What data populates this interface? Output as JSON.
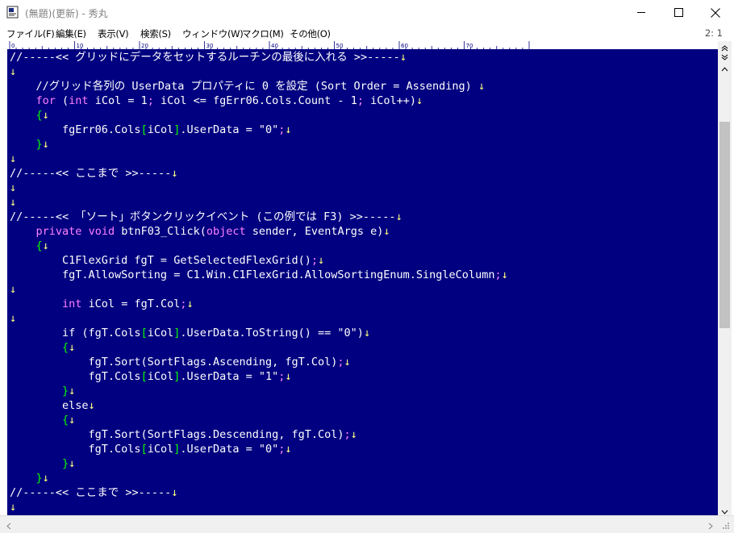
{
  "window": {
    "title": "(無題)(更新) - 秀丸"
  },
  "menu": {
    "items": [
      "ファイル(F)",
      "編集(E)",
      "表示(V)",
      "検索(S)",
      "ウィンドウ(W)",
      "マクロ(M)",
      "その他(O)"
    ],
    "position": "2: 1"
  },
  "ruler": {
    "labels": [
      "0",
      "10",
      "20",
      "30",
      "40",
      "50",
      "60",
      "70"
    ]
  },
  "editor": {
    "colors": {
      "background": "#000080",
      "text": "#ffffff",
      "keyword": "#ff80ff",
      "bracket": "#00ff00",
      "return_mark": "#ffff80"
    },
    "lines": [
      [
        [
          "c",
          "//-----<< グリッドにデータをセットするルーチンの最後に入れる >>-----"
        ],
        [
          "r",
          "↓"
        ]
      ],
      [
        [
          "r",
          "↓"
        ]
      ],
      [
        [
          "t",
          "    //グリッド各列の UserData プロパティに 0 を設定 (Sort Order = Assending) "
        ],
        [
          "r",
          "↓"
        ]
      ],
      [
        [
          "t",
          "    "
        ],
        [
          "k",
          "for"
        ],
        [
          "t",
          " ("
        ],
        [
          "k",
          "int"
        ],
        [
          "t",
          " iCol = 1"
        ],
        [
          "k",
          ";"
        ],
        [
          "t",
          " iCol <= fgErr06.Cols.Count - 1"
        ],
        [
          "k",
          ";"
        ],
        [
          "t",
          " iCol++)"
        ],
        [
          "r",
          "↓"
        ]
      ],
      [
        [
          "t",
          "    "
        ],
        [
          "b",
          "{"
        ],
        [
          "r",
          "↓"
        ]
      ],
      [
        [
          "t",
          "        fgErr06.Cols"
        ],
        [
          "b",
          "["
        ],
        [
          "t",
          "iCol"
        ],
        [
          "b",
          "]"
        ],
        [
          "t",
          ".UserData = \"0\""
        ],
        [
          "k",
          ";"
        ],
        [
          "r",
          "↓"
        ]
      ],
      [
        [
          "t",
          "    "
        ],
        [
          "b",
          "}"
        ],
        [
          "r",
          "↓"
        ]
      ],
      [
        [
          "r",
          "↓"
        ]
      ],
      [
        [
          "c",
          "//-----<< ここまで >>-----"
        ],
        [
          "r",
          "↓"
        ]
      ],
      [
        [
          "r",
          "↓"
        ]
      ],
      [
        [
          "r",
          "↓"
        ]
      ],
      [
        [
          "c",
          "//-----<< 「ソート」ボタンクリックイベント (この例では F3) >>-----"
        ],
        [
          "r",
          "↓"
        ]
      ],
      [
        [
          "t",
          "    "
        ],
        [
          "k",
          "private"
        ],
        [
          "t",
          " "
        ],
        [
          "k",
          "void"
        ],
        [
          "t",
          " btnF03_Click("
        ],
        [
          "k",
          "object"
        ],
        [
          "t",
          " sender, EventArgs e)"
        ],
        [
          "r",
          "↓"
        ]
      ],
      [
        [
          "t",
          "    "
        ],
        [
          "b",
          "{"
        ],
        [
          "r",
          "↓"
        ]
      ],
      [
        [
          "t",
          "        C1FlexGrid fgT = GetSelectedFlexGrid()"
        ],
        [
          "k",
          ";"
        ],
        [
          "r",
          "↓"
        ]
      ],
      [
        [
          "t",
          "        fgT.AllowSorting = C1.Win.C1FlexGrid.AllowSortingEnum.SingleColumn"
        ],
        [
          "k",
          ";"
        ],
        [
          "r",
          "↓"
        ]
      ],
      [
        [
          "r",
          "↓"
        ]
      ],
      [
        [
          "t",
          "        "
        ],
        [
          "k",
          "int"
        ],
        [
          "t",
          " iCol = fgT.Col"
        ],
        [
          "k",
          ";"
        ],
        [
          "r",
          "↓"
        ]
      ],
      [
        [
          "r",
          "↓"
        ]
      ],
      [
        [
          "t",
          "        if (fgT.Cols"
        ],
        [
          "b",
          "["
        ],
        [
          "t",
          "iCol"
        ],
        [
          "b",
          "]"
        ],
        [
          "t",
          ".UserData.ToString() == \"0\")"
        ],
        [
          "r",
          "↓"
        ]
      ],
      [
        [
          "t",
          "        "
        ],
        [
          "b",
          "{"
        ],
        [
          "r",
          "↓"
        ]
      ],
      [
        [
          "t",
          "            fgT.Sort(SortFlags.Ascending, fgT.Col)"
        ],
        [
          "k",
          ";"
        ],
        [
          "r",
          "↓"
        ]
      ],
      [
        [
          "t",
          "            fgT.Cols"
        ],
        [
          "b",
          "["
        ],
        [
          "t",
          "iCol"
        ],
        [
          "b",
          "]"
        ],
        [
          "t",
          ".UserData = \"1\""
        ],
        [
          "k",
          ";"
        ],
        [
          "r",
          "↓"
        ]
      ],
      [
        [
          "t",
          "        "
        ],
        [
          "b",
          "}"
        ],
        [
          "r",
          "↓"
        ]
      ],
      [
        [
          "t",
          "        else"
        ],
        [
          "r",
          "↓"
        ]
      ],
      [
        [
          "t",
          "        "
        ],
        [
          "b",
          "{"
        ],
        [
          "r",
          "↓"
        ]
      ],
      [
        [
          "t",
          "            fgT.Sort(SortFlags.Descending, fgT.Col)"
        ],
        [
          "k",
          ";"
        ],
        [
          "r",
          "↓"
        ]
      ],
      [
        [
          "t",
          "            fgT.Cols"
        ],
        [
          "b",
          "["
        ],
        [
          "t",
          "iCol"
        ],
        [
          "b",
          "]"
        ],
        [
          "t",
          ".UserData = \"0\""
        ],
        [
          "k",
          ";"
        ],
        [
          "r",
          "↓"
        ]
      ],
      [
        [
          "t",
          "        "
        ],
        [
          "b",
          "}"
        ],
        [
          "r",
          "↓"
        ]
      ],
      [
        [
          "t",
          "    "
        ],
        [
          "b",
          "}"
        ],
        [
          "r",
          "↓"
        ]
      ],
      [
        [
          "c",
          "//-----<< ここまで >>-----"
        ],
        [
          "r",
          "↓"
        ]
      ],
      [
        [
          "r",
          "↓"
        ]
      ]
    ]
  },
  "icons": {
    "app": "hidemaru-app-icon",
    "minimize": "minimize-icon",
    "maximize": "maximize-icon",
    "close": "close-icon"
  }
}
